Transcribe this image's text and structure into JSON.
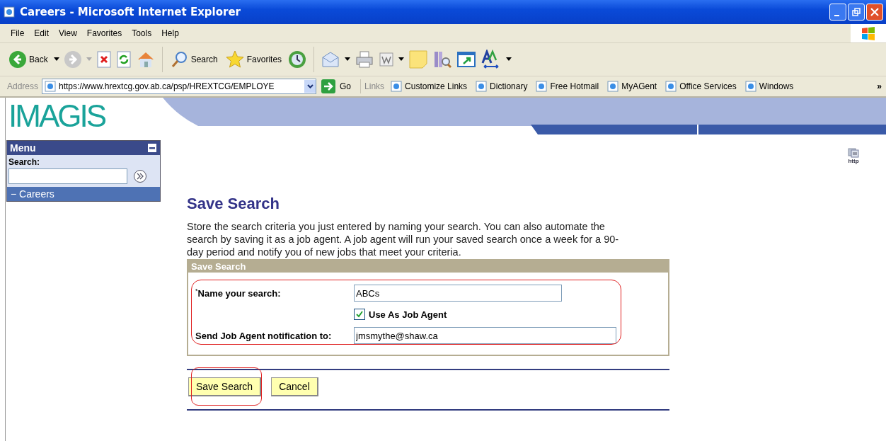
{
  "window": {
    "title": "Careers - Microsoft Internet Explorer"
  },
  "menu_bar": [
    "File",
    "Edit",
    "View",
    "Favorites",
    "Tools",
    "Help"
  ],
  "toolbar": {
    "back_label": "Back",
    "search_label": "Search",
    "favorites_label": "Favorites"
  },
  "address_bar": {
    "label": "Address",
    "url": "https://www.hrextcg.gov.ab.ca/psp/HREXTCG/EMPLOYE",
    "go_label": "Go"
  },
  "links_bar": {
    "label": "Links",
    "items": [
      "Customize Links",
      "Dictionary",
      "Free Hotmail",
      "MyAGent",
      "Office Services",
      "Windows"
    ],
    "more": "»"
  },
  "site": {
    "logo": "IMAGIS"
  },
  "sidebar": {
    "title": "Menu",
    "search_label": "Search:",
    "items": [
      {
        "toggle": "−",
        "label": "Careers",
        "selected": true
      }
    ]
  },
  "page": {
    "title": "Save Search",
    "description": "Store the search criteria you just entered by naming your search. You can also automate the search by saving it as a job agent. A job agent will run your saved search once a week for a 90-day period and notify you of new jobs that meet your criteria.",
    "http_label": "http"
  },
  "form": {
    "title": "Save Search",
    "highlighted": true,
    "fields": [
      {
        "kind": "text",
        "required_mark": "*",
        "label": "Name your search:",
        "value": "ABCs"
      },
      {
        "kind": "checkbox",
        "label": "Use As Job Agent",
        "checked": true
      },
      {
        "kind": "text",
        "label": "Send Job Agent notification to:",
        "value": "jmsmythe@shaw.ca"
      }
    ]
  },
  "buttons": [
    {
      "label": "Save Search",
      "highlighted": true
    },
    {
      "label": "Cancel",
      "highlighted": false
    }
  ]
}
